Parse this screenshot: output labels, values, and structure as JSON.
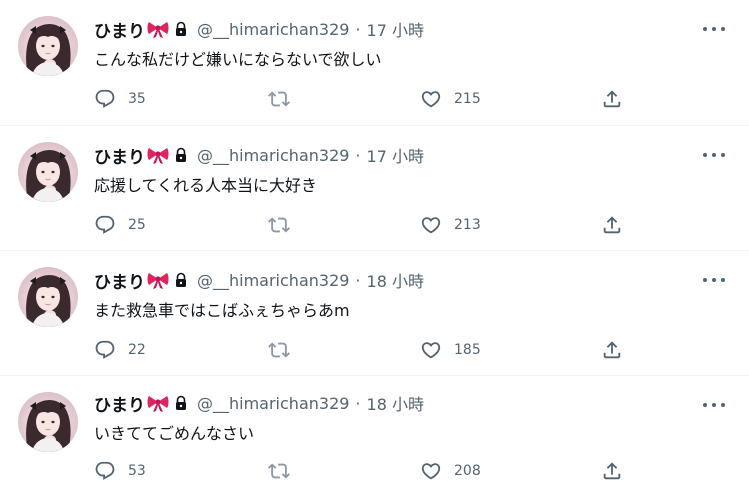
{
  "colors": {
    "text": "#0f1419",
    "muted": "#536471",
    "divider": "#eff3f4",
    "bow": "#e0245e"
  },
  "icons": {
    "reply": "reply-icon",
    "retweet": "retweet-icon",
    "like": "heart-icon",
    "share": "share-icon",
    "more": "more-icon",
    "protected": "lock-icon",
    "emoji": "ribbon-emoji"
  },
  "tweets": [
    {
      "name": "ひまり",
      "handle": "@__himarichan329",
      "sep": "·",
      "time": "17 小時",
      "text": "こんな私だけど嫌いにならないで欲しい",
      "replies": "35",
      "likes": "215"
    },
    {
      "name": "ひまり",
      "handle": "@__himarichan329",
      "sep": "·",
      "time": "17 小時",
      "text": "応援してくれる人本当に大好き",
      "replies": "25",
      "likes": "213"
    },
    {
      "name": "ひまり",
      "handle": "@__himarichan329",
      "sep": "·",
      "time": "18 小時",
      "text": "また救急車ではこばふぇちゃらあm",
      "replies": "22",
      "likes": "185"
    },
    {
      "name": "ひまり",
      "handle": "@__himarichan329",
      "sep": "·",
      "time": "18 小時",
      "text": "いきててごめんなさい",
      "replies": "53",
      "likes": "208"
    }
  ]
}
